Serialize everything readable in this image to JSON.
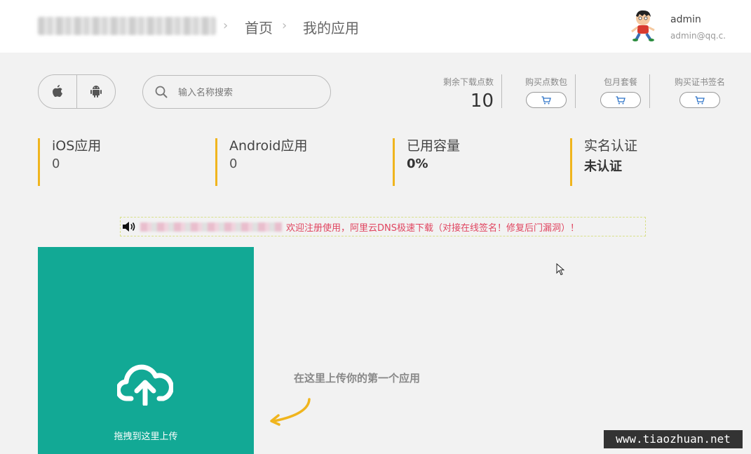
{
  "header": {
    "breadcrumb": [
      "首页",
      "我的应用"
    ],
    "user": {
      "name": "admin",
      "email": "admin@qq.c..."
    }
  },
  "toolbar": {
    "os_filter": [
      {
        "icon": "apple-icon"
      },
      {
        "icon": "android-icon"
      }
    ],
    "search": {
      "placeholder": "输入名称搜索",
      "value": ""
    }
  },
  "account": {
    "remaining_label": "剩余下载点数",
    "remaining_value": "10",
    "buy_points_label": "购买点数包",
    "monthly_plan_label": "包月套餐",
    "buy_cert_label": "购买证书签名"
  },
  "summary": [
    {
      "title": "iOS应用",
      "value": "0",
      "bold": false
    },
    {
      "title": "Android应用",
      "value": "0",
      "bold": false
    },
    {
      "title": "已用容量",
      "value": "0%",
      "bold": true
    },
    {
      "title": "实名认证",
      "value": "未认证",
      "bold": true
    }
  ],
  "notice": {
    "icon": "speaker-icon",
    "message": "欢迎注册使用，阿里云DNS极速下载（对接在线签名！修复后门漏洞）！"
  },
  "upload": {
    "label": "拖拽到这里上传",
    "hint": "在这里上传你的第一个应用"
  },
  "watermark": "www.tiaozhuan.net",
  "colors": {
    "accent": "#f0b51e",
    "upload_bg": "#12a995",
    "notice_text": "#e0445f"
  }
}
